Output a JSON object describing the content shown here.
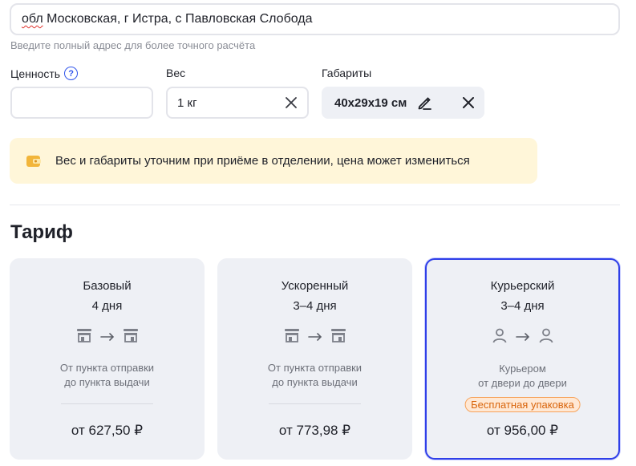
{
  "address": {
    "squiggle_word": "обл",
    "rest": " Московская, г Истра, с Павловская Слобода",
    "hint": "Введите полный адрес для более точного расчёта"
  },
  "fields": {
    "value_label": "Ценность",
    "value_help_glyph": "?",
    "value_input": "",
    "weight_label": "Вес",
    "weight_input": "1 кг",
    "dims_label": "Габариты",
    "dims_value": "40x29x19 см"
  },
  "notice": {
    "text": "Вес и габариты уточним при приёме в отделении, цена может измениться"
  },
  "tariff": {
    "title": "Тариф",
    "cards": [
      {
        "name": "Базовый",
        "days": "4 дня",
        "desc_line1": "От пункта отправки",
        "desc_line2": "до пункта выдачи",
        "price": "от 627,50 ₽",
        "icon_from": "pickup-point-icon",
        "icon_to": "pickup-point-icon"
      },
      {
        "name": "Ускоренный",
        "days": "3–4 дня",
        "desc_line1": "От пункта отправки",
        "desc_line2": "до пункта выдачи",
        "price": "от 773,98 ₽",
        "icon_from": "pickup-point-icon",
        "icon_to": "pickup-point-icon"
      },
      {
        "name": "Курьерский",
        "days": "3–4 дня",
        "desc_line1": "Курьером",
        "desc_line2": "от двери до двери",
        "badge": "Бесплатная упаковка",
        "price": "от 956,00 ₽",
        "icon_from": "person-icon",
        "icon_to": "person-icon",
        "selected": true
      }
    ]
  },
  "colors": {
    "accent": "#2f3fe8",
    "notice_bg": "#fff6d9",
    "card_bg": "#eef0f5",
    "badge_text": "#d9650c"
  }
}
